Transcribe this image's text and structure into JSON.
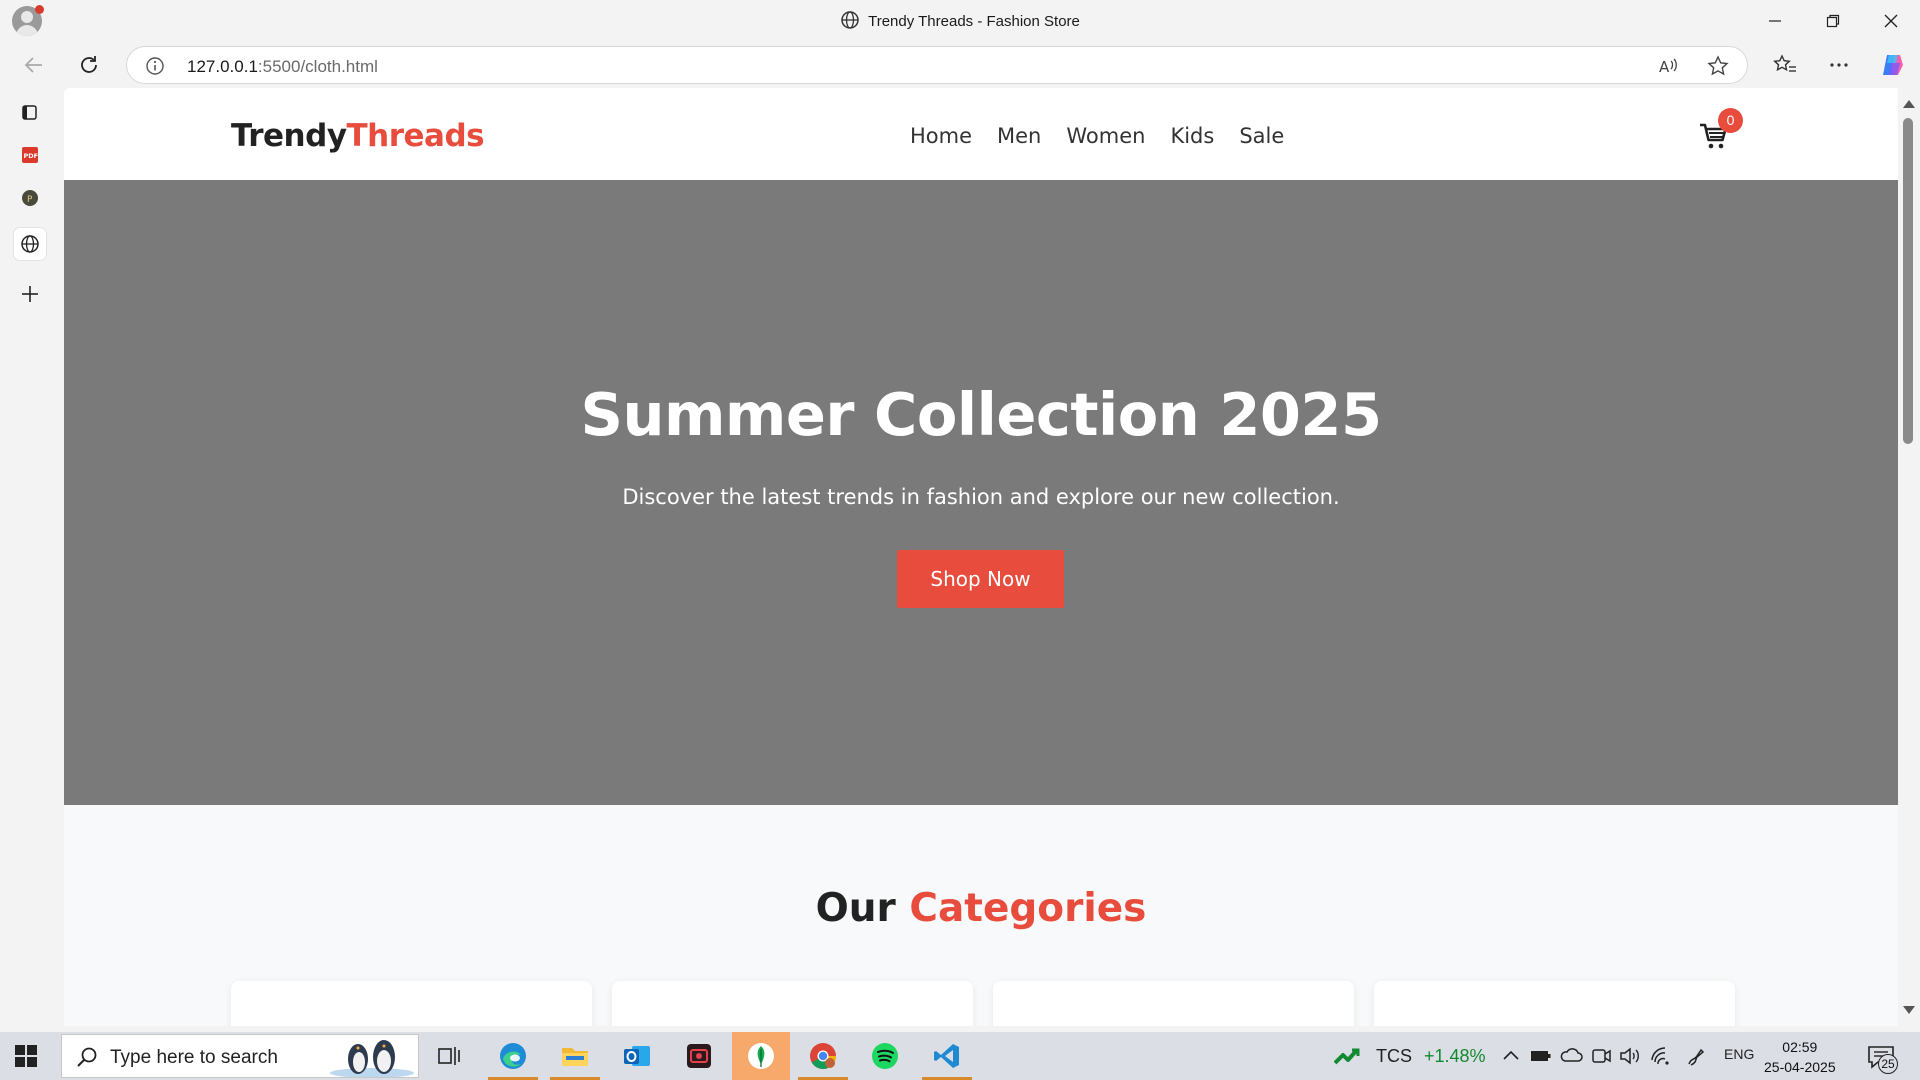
{
  "window": {
    "title": "Trendy Threads - Fashion Store"
  },
  "address_bar": {
    "url_host": "127.0.0.1",
    "url_rest": ":5500/cloth.html"
  },
  "site": {
    "logo_part1": "Trendy",
    "logo_part2": "Threads",
    "nav": [
      "Home",
      "Men",
      "Women",
      "Kids",
      "Sale"
    ],
    "cart_count": "0",
    "hero": {
      "title": "Summer Collection 2025",
      "subtitle": "Discover the latest trends in fashion and explore our new collection.",
      "button": "Shop Now"
    },
    "categories_title_part1": "Our",
    "categories_title_part2": "Categories"
  },
  "taskbar": {
    "search_placeholder": "Type here to search",
    "stock_name": "TCS",
    "stock_change": "+1.48%",
    "language": "ENG",
    "time": "02:59",
    "date": "25-04-2025",
    "notification_count": "25"
  },
  "colors": {
    "accent": "#e74c3c",
    "hero_bg": "#7a7a7a",
    "stock_up": "#128a2f"
  }
}
